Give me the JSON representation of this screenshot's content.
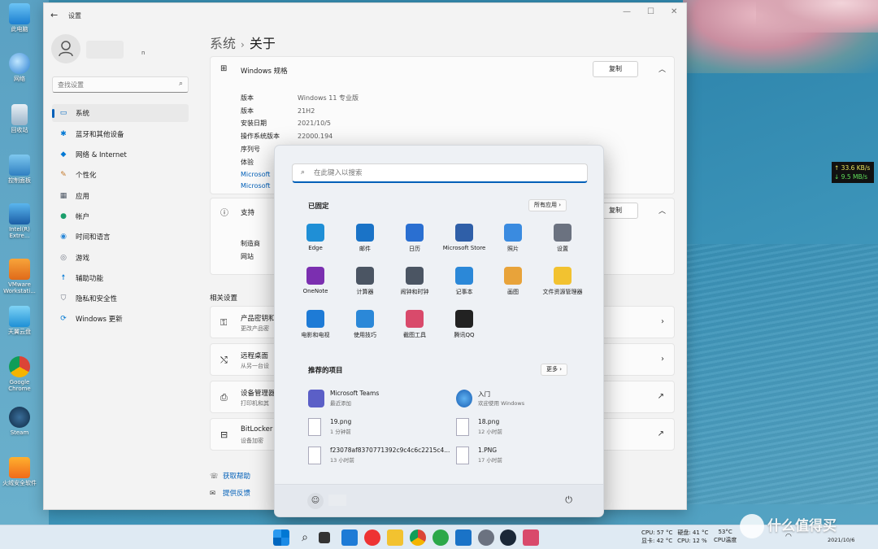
{
  "desktop": {
    "icons": [
      {
        "label": "此电脑"
      },
      {
        "label": "网络"
      },
      {
        "label": "回收站"
      },
      {
        "label": "控制面板"
      },
      {
        "label": "Intel(R) Extre..."
      },
      {
        "label": "VMware Workstati..."
      },
      {
        "label": "天翼云盘"
      },
      {
        "label": "Google Chrome"
      },
      {
        "label": "Steam"
      },
      {
        "label": "火绒安全软件"
      }
    ],
    "net_speed": {
      "up": "↑ 33.6 KB/s",
      "down": "↓ 9.5 MB/s"
    }
  },
  "settings": {
    "window_title": "设置",
    "profile_suffix": "n",
    "search_placeholder": "查找设置",
    "nav": [
      {
        "label": "系统",
        "icon": "monitor-icon"
      },
      {
        "label": "蓝牙和其他设备",
        "icon": "bluetooth-icon"
      },
      {
        "label": "网络 & Internet",
        "icon": "wifi-icon"
      },
      {
        "label": "个性化",
        "icon": "brush-icon"
      },
      {
        "label": "应用",
        "icon": "apps-icon"
      },
      {
        "label": "帐户",
        "icon": "person-icon"
      },
      {
        "label": "时间和语言",
        "icon": "globe-icon"
      },
      {
        "label": "游戏",
        "icon": "gamepad-icon"
      },
      {
        "label": "辅助功能",
        "icon": "accessibility-icon"
      },
      {
        "label": "隐私和安全性",
        "icon": "shield-icon"
      },
      {
        "label": "Windows 更新",
        "icon": "update-icon"
      }
    ],
    "breadcrumb": {
      "parent": "系统",
      "current": "关于"
    },
    "spec_card": {
      "title": "Windows 规格",
      "copy": "复制",
      "rows": [
        {
          "k": "版本",
          "v": "Windows 11 专业版"
        },
        {
          "k": "版本",
          "v": "21H2"
        },
        {
          "k": "安装日期",
          "v": "2021/10/5"
        },
        {
          "k": "操作系统版本",
          "v": "22000.194"
        },
        {
          "k": "序列号",
          "v": ""
        },
        {
          "k": "体验",
          "v": ""
        }
      ],
      "links": [
        "Microsoft",
        "Microsoft"
      ]
    },
    "support_card": {
      "title": "支持",
      "copy": "复制",
      "rows": [
        {
          "k": "制造商"
        },
        {
          "k": "网站"
        }
      ]
    },
    "related_title": "相关设置",
    "related": [
      {
        "title": "产品密钥和",
        "sub": "更改产品密",
        "icon": "key-icon",
        "chev": "›"
      },
      {
        "title": "远程桌面",
        "sub": "从另一台设",
        "icon": "remote-icon",
        "chev": "›"
      },
      {
        "title": "设备管理器",
        "sub": "打印机和其",
        "icon": "printer-icon",
        "chev": "↗"
      },
      {
        "title": "BitLocker",
        "sub": "设备加密",
        "icon": "lock-icon",
        "chev": "↗"
      }
    ],
    "help_links": [
      "获取帮助",
      "提供反馈"
    ]
  },
  "start_menu": {
    "search_placeholder": "在此键入以搜索",
    "pinned_title": "已固定",
    "all_apps": "所有应用  ›",
    "pinned": [
      {
        "label": "Edge",
        "color": "#1f8fd6"
      },
      {
        "label": "邮件",
        "color": "#1a73c7"
      },
      {
        "label": "日历",
        "color": "#2a6fd1"
      },
      {
        "label": "Microsoft Store",
        "color": "#2f5fa8"
      },
      {
        "label": "照片",
        "color": "#3a8be0"
      },
      {
        "label": "设置",
        "color": "#6b7280"
      },
      {
        "label": "OneNote",
        "color": "#7b2fb0"
      },
      {
        "label": "计算器",
        "color": "#4b5563"
      },
      {
        "label": "闹钟和时钟",
        "color": "#4b5563"
      },
      {
        "label": "记事本",
        "color": "#2b88d8"
      },
      {
        "label": "画图",
        "color": "#e8a33a"
      },
      {
        "label": "文件资源管理器",
        "color": "#f2c230"
      },
      {
        "label": "电影和电视",
        "color": "#1e7bd6"
      },
      {
        "label": "使用技巧",
        "color": "#2b88d8"
      },
      {
        "label": "截图工具",
        "color": "#d94a6b"
      },
      {
        "label": "腾讯QQ",
        "color": "#222222"
      }
    ],
    "recommended_title": "推荐的项目",
    "more": "更多  ›",
    "recommended": [
      {
        "name": "Microsoft Teams",
        "time": "最近添加"
      },
      {
        "name": "入门",
        "time": "欢迎使用 Windows"
      },
      {
        "name": "19.png",
        "time": "1 分钟前"
      },
      {
        "name": "18.png",
        "time": "12 小时前"
      },
      {
        "name": "f23078af8370771392c9c4c6c2215c4...",
        "time": "13 小时前"
      },
      {
        "name": "1.PNG",
        "time": "17 小时前"
      }
    ]
  },
  "taskbar": {
    "cpu": "CPU: 57 °C",
    "disk": "硬盘: 41 °C",
    "gpu": "显卡: 42 °C",
    "cpu_use": "CPU: 12 %",
    "temp_value": "53°C",
    "temp_label": "CPU温度",
    "date": "2021/10/6"
  },
  "watermark": "什么值得买"
}
